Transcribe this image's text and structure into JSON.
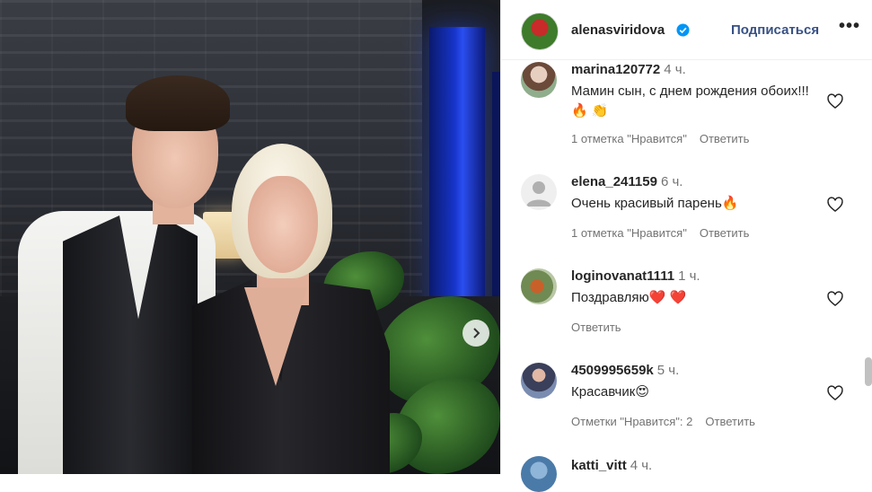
{
  "post": {
    "author": "alenasviridova",
    "verified": true,
    "follow_label": "Подписаться",
    "more_label": "•••",
    "carousel_next": "›"
  },
  "comments": [
    {
      "user": "marina120772",
      "time": "4 ч.",
      "text": "Мамин сын, с днем рождения обоих!!! 🔥 👏",
      "likes": "1 отметка \"Нравится\"",
      "reply": "Ответить"
    },
    {
      "user": "elena_241159",
      "time": "6 ч.",
      "text": "Очень красивый парень🔥",
      "likes": "1 отметка \"Нравится\"",
      "reply": "Ответить"
    },
    {
      "user": "loginovanat1111",
      "time": "1 ч.",
      "text": "Поздравляю❤️ ❤️",
      "likes": "",
      "reply": "Ответить"
    },
    {
      "user": "4509995659k",
      "time": "5 ч.",
      "text": "Красавчик😍",
      "likes": "Отметки \"Нравится\": 2",
      "reply": "Ответить"
    },
    {
      "user": "katti_vitt",
      "time": "4 ч.",
      "text": "",
      "likes": "",
      "reply": ""
    }
  ],
  "colors": {
    "link": "#385185",
    "verified": "#0095f6",
    "muted": "#737373"
  },
  "icons": [
    "verified-badge-icon",
    "more-options-icon",
    "heart-icon",
    "chevron-right-icon",
    "default-avatar-icon"
  ]
}
